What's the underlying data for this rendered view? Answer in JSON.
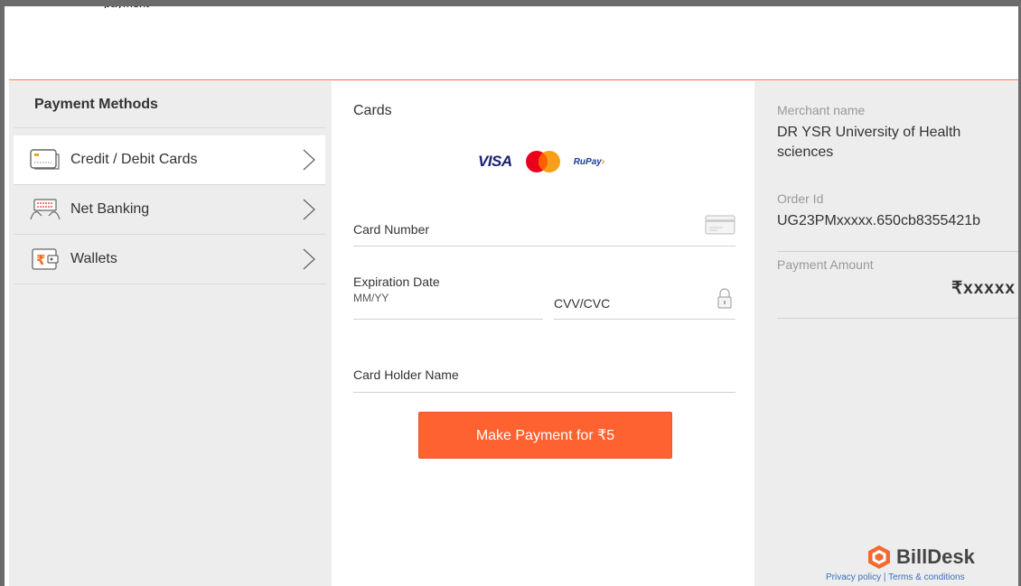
{
  "top_caption": "payment",
  "left": {
    "title": "Payment Methods",
    "methods": [
      {
        "label": "Credit / Debit Cards",
        "icon": "credit-card-icon",
        "active": true
      },
      {
        "label": "Net Banking",
        "icon": "net-banking-icon",
        "active": false
      },
      {
        "label": "Wallets",
        "icon": "wallet-icon",
        "active": false
      }
    ]
  },
  "center": {
    "title": "Cards",
    "brands": {
      "visa": "VISA",
      "rupay": "RuPay"
    },
    "card_number_label": "Card Number",
    "expiration_label": "Expiration Date",
    "expiration_placeholder": "MM/YY",
    "cvv_label": "CVV/CVC",
    "holder_label": "Card Holder Name",
    "pay_button": "Make Payment for ₹5"
  },
  "right": {
    "merchant_label": "Merchant name",
    "merchant_value": "DR YSR University of Health sciences",
    "order_label": "Order Id",
    "order_value": "UG23PMxxxxx.650cb8355421b",
    "amount_label": "Payment Amount",
    "amount_value": "₹xxxxx",
    "brand": "BillDesk",
    "privacy": "Privacy policy",
    "separator": "|",
    "terms": "Terms & conditions"
  },
  "colors": {
    "accent": "#fe6230",
    "panel_bg": "#ededed",
    "link": "#3a6fc4"
  }
}
